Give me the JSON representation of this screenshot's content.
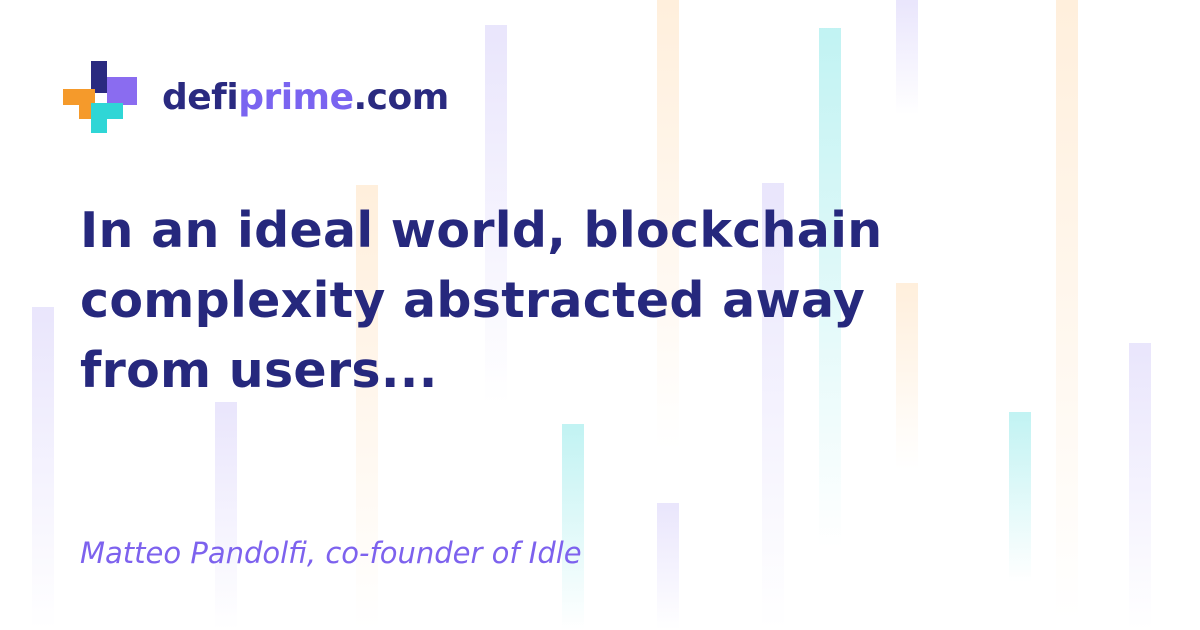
{
  "logo": {
    "name_part1": "defi",
    "name_part2": "prime",
    "name_part3": ".com",
    "colors": {
      "navy": "#2a2a80",
      "purple": "#7a64f0",
      "orange": "#f59a2b",
      "cyan": "#2fd6d6"
    }
  },
  "quote": {
    "text": "In an ideal world, blockchain complexity abstracted away from users...",
    "attribution": "Matteo Pandolfi, co-founder of Idle"
  },
  "colors": {
    "headline": "#26287d",
    "attribution": "#7d62ee",
    "background": "#ffffff"
  }
}
